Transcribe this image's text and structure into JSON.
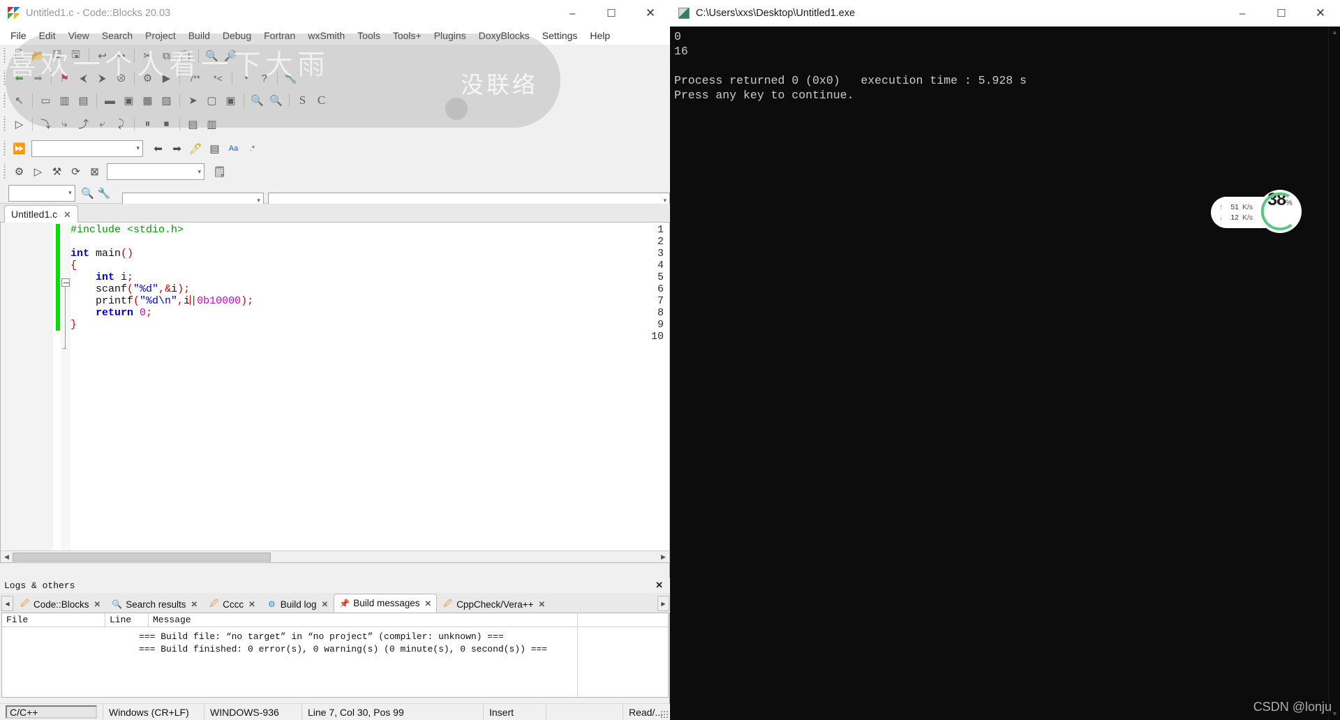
{
  "console": {
    "title": "C:\\Users\\xxs\\Desktop\\Untitled1.exe",
    "icon": "console-app-icon",
    "minimize": "–",
    "maximize": "☐",
    "close": "✕",
    "output": "0\n16\n\nProcess returned 0 (0x0)   execution time : 5.928 s\nPress any key to continue.",
    "watermark": "CSDN @lonju",
    "scroll_up": "▲",
    "scroll_down": "▼"
  },
  "net_widget": {
    "up_arrow": "↑",
    "up_value": "51",
    "up_unit": "K/s",
    "down_arrow": "↓",
    "down_value": "12",
    "down_unit": "K/s",
    "percent": "38",
    "percent_sign": "%",
    "ring_color": "#57c97e"
  },
  "codeblocks": {
    "title": "Untitled1.c - Code::Blocks 20.03",
    "window_buttons": {
      "minimize": "–",
      "maximize": "☐",
      "close": "✕"
    },
    "menu": [
      "File",
      "Edit",
      "View",
      "Search",
      "Project",
      "Build",
      "Debug",
      "Fortran",
      "wxSmith",
      "Tools",
      "Tools+",
      "Plugins",
      "DoxyBlocks",
      "Settings",
      "Help"
    ],
    "watermark_line1": "喜欢一个人看一下大雨",
    "watermark_line2": "没联络",
    "toolbar_main": [
      "new-file-icon",
      "open-file-icon",
      "save-icon",
      "save-all-icon",
      "undo-icon",
      "redo-icon",
      "cut-icon",
      "copy-icon",
      "paste-icon",
      "find-icon",
      "replace-icon"
    ],
    "toolbar_nav": [
      "back-icon",
      "forward-icon",
      "bookmark-icon",
      "prev-bookmark-icon",
      "next-bookmark-icon",
      "clear-bookmarks-icon",
      "build-icon",
      "run-icon",
      "comment-icon",
      "uncomment-icon",
      "debug-window-icon",
      "help-icon",
      "settings-wrench-icon"
    ],
    "toolbar_wx": [
      "pointer-icon",
      "panel-icon",
      "grid-icon",
      "sizer-icon",
      "box-icon",
      "button-icon",
      "control-icon",
      "dialog-icon",
      "arrow-tool-icon",
      "frame-icon",
      "zoom-in-icon",
      "zoom-out-icon",
      "s-icon",
      "c-icon"
    ],
    "toolbar_debug": [
      "debug-run-icon",
      "step-icon",
      "step-into-icon",
      "step-out-icon",
      "next-instr-icon",
      "step-instr-icon",
      "break-icon",
      "stop-icon",
      "debug-info-icon",
      "watches-icon"
    ],
    "toolbar_target_value": "",
    "toolbar_target_icons": [
      "goto-declaration-icon",
      "goto-implementation-icon",
      "highlight-icon",
      "scope-icon",
      "match-case-icon",
      "regex-icon"
    ],
    "toolbar_compiler_value": "",
    "toolbar_compiler_icons": [
      "gear-icon",
      "run-icon",
      "build-icon",
      "rebuild-icon",
      "abort-icon",
      "notes-icon"
    ],
    "toolbar_search_value": "",
    "toolbar_search_icons": [
      "search-files-icon",
      "search-settings-icon"
    ],
    "editor_tab": {
      "label": "Untitled1.c",
      "close": "✕"
    },
    "code_lines": [
      {
        "n": "1",
        "tokens": [
          {
            "t": "#include ",
            "c": "pre"
          },
          {
            "t": "<stdio.h>",
            "c": "pre"
          }
        ]
      },
      {
        "n": "2",
        "tokens": []
      },
      {
        "n": "3",
        "tokens": [
          {
            "t": "int",
            "c": "kw"
          },
          {
            "t": " main",
            "c": "fn"
          },
          {
            "t": "()",
            "c": "par"
          }
        ]
      },
      {
        "n": "4",
        "tokens": [
          {
            "t": "{",
            "c": "par"
          }
        ]
      },
      {
        "n": "5",
        "tokens": [
          {
            "t": "    ",
            "c": "pln"
          },
          {
            "t": "int",
            "c": "kw"
          },
          {
            "t": " i",
            "c": "pln"
          },
          {
            "t": ";",
            "c": "op"
          }
        ]
      },
      {
        "n": "6",
        "tokens": [
          {
            "t": "    scanf",
            "c": "pln"
          },
          {
            "t": "(",
            "c": "par"
          },
          {
            "t": "\"%d\"",
            "c": "str"
          },
          {
            "t": ",",
            "c": "op"
          },
          {
            "t": "&",
            "c": "op"
          },
          {
            "t": "i",
            "c": "pln"
          },
          {
            "t": ")",
            "c": "par"
          },
          {
            "t": ";",
            "c": "op"
          }
        ]
      },
      {
        "n": "7",
        "tokens": [
          {
            "t": "    printf",
            "c": "pln"
          },
          {
            "t": "(",
            "c": "par"
          },
          {
            "t": "\"%d\\n\"",
            "c": "str"
          },
          {
            "t": ",",
            "c": "op"
          },
          {
            "t": "i",
            "c": "pln"
          },
          {
            "t": "|",
            "c": "caret"
          },
          {
            "t": "0b10000",
            "c": "num"
          },
          {
            "t": ")",
            "c": "par"
          },
          {
            "t": ";",
            "c": "op"
          }
        ]
      },
      {
        "n": "8",
        "tokens": [
          {
            "t": "    ",
            "c": "pln"
          },
          {
            "t": "return",
            "c": "kw"
          },
          {
            "t": " ",
            "c": "pln"
          },
          {
            "t": "0",
            "c": "num"
          },
          {
            "t": ";",
            "c": "op"
          }
        ]
      },
      {
        "n": "9",
        "tokens": [
          {
            "t": "}",
            "c": "par"
          }
        ]
      },
      {
        "n": "10",
        "tokens": []
      }
    ],
    "logs": {
      "header_title": "Logs & others",
      "header_close": "✕",
      "scroll_left": "◀",
      "scroll_right": "▶",
      "tabs": [
        {
          "label": "Code::Blocks",
          "icon": "pencil-icon",
          "close": "✕",
          "active": false
        },
        {
          "label": "Search results",
          "icon": "magnifier-icon",
          "close": "✕",
          "active": false
        },
        {
          "label": "Cccc",
          "icon": "pencil-icon",
          "close": "✕",
          "active": false
        },
        {
          "label": "Build log",
          "icon": "gear-icon",
          "close": "✕",
          "active": false
        },
        {
          "label": "Build messages",
          "icon": "pin-icon",
          "close": "✕",
          "active": true
        },
        {
          "label": "CppCheck/Vera++",
          "icon": "pencil-icon",
          "close": "✕",
          "active": false
        }
      ],
      "columns": [
        "File",
        "Line",
        "Message"
      ],
      "messages": "=== Build file: “no target” in “no project” (compiler: unknown) ===\n=== Build finished: 0 error(s), 0 warning(s) (0 minute(s), 0 second(s)) ==="
    },
    "statusbar": {
      "language": "C/C++",
      "eol": "Windows (CR+LF)",
      "encoding": "WINDOWS-936",
      "caret": "Line 7, Col 30, Pos 99",
      "insert_mode": "Insert",
      "blank": "",
      "readonly": "Read/..."
    }
  }
}
